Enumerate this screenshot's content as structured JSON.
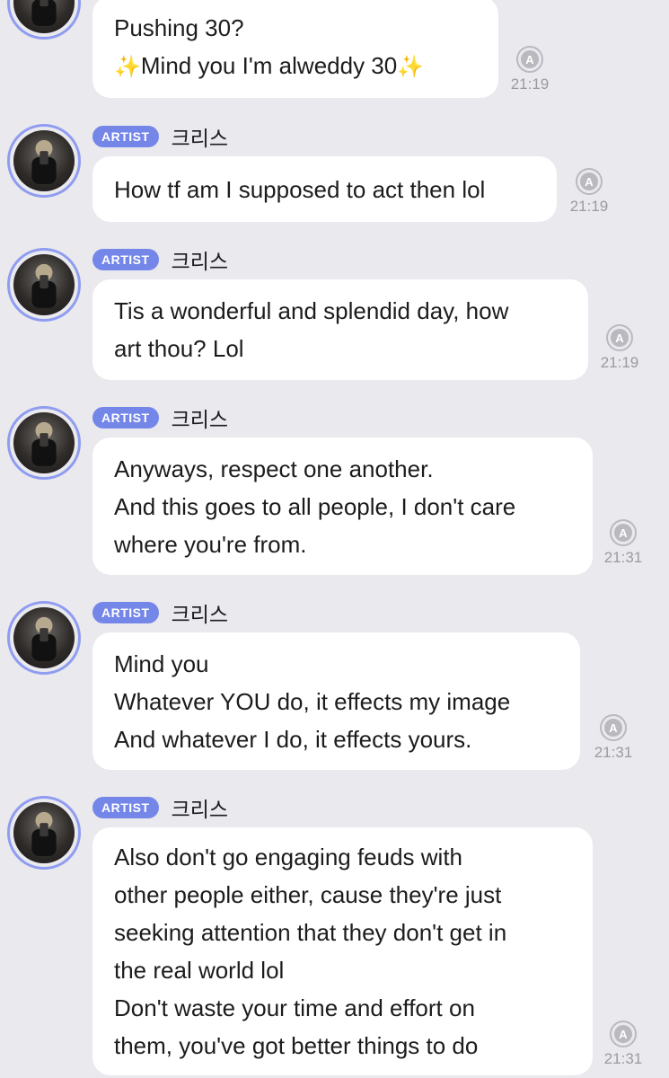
{
  "badge": "ARTIST",
  "sender": "크리스",
  "messages": [
    {
      "lines": [
        "Pushing 30?",
        "Mind you I'm alweddy 30"
      ],
      "time": "21:19"
    },
    {
      "lines": [
        "How tf am I supposed to act then lol"
      ],
      "time": "21:19"
    },
    {
      "lines": [
        "Tis a wonderful and splendid day, how",
        "art thou? Lol"
      ],
      "time": "21:19"
    },
    {
      "lines": [
        "Anyways, respect one another.",
        "And this goes to all people, I don't care",
        "where you're from."
      ],
      "time": "21:31"
    },
    {
      "lines": [
        "Mind you",
        "Whatever YOU do, it effects my image",
        "And whatever I do, it effects yours."
      ],
      "time": "21:31"
    },
    {
      "lines": [
        "Also don't go engaging feuds with",
        "other people either, cause they're just",
        "seeking attention that they don't get in",
        "the real world lol",
        "Don't waste your time and effort on",
        "them, you've got better things to do"
      ],
      "time": "21:31"
    }
  ]
}
